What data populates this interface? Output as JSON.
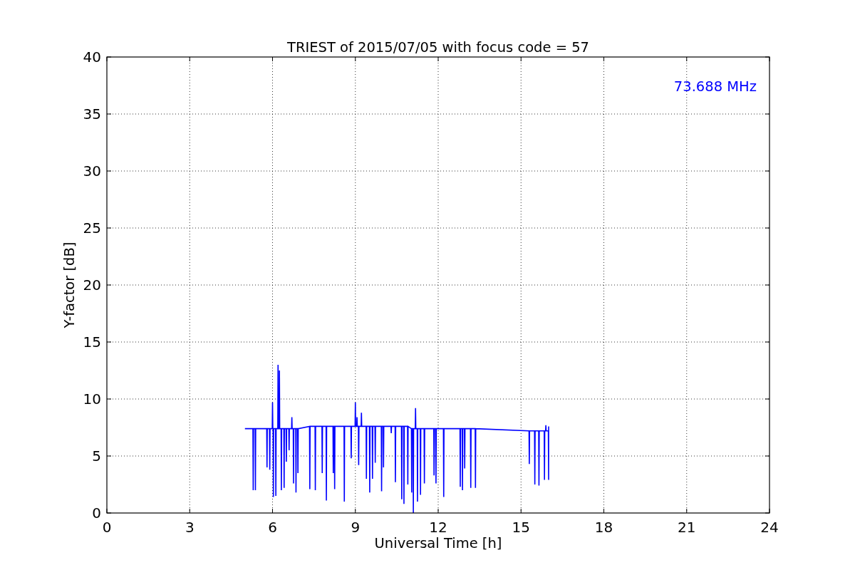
{
  "figure": {
    "chart_data": {
      "type": "line",
      "title": "TRIEST of 2015/07/05 with focus code = 57",
      "xlabel": "Universal Time [h]",
      "ylabel": "Y-factor [dB]",
      "xlim": [
        0,
        24
      ],
      "ylim": [
        0,
        40
      ],
      "xticks": [
        0,
        3,
        6,
        9,
        12,
        15,
        18,
        21,
        24
      ],
      "yticks": [
        0,
        5,
        10,
        15,
        20,
        25,
        30,
        35,
        40
      ],
      "x": [
        5.0,
        5.29,
        5.3,
        5.31,
        5.37,
        5.38,
        5.39,
        5.79,
        5.8,
        5.81,
        5.89,
        5.9,
        5.91,
        5.99,
        6.0,
        6.01,
        6.02,
        6.03,
        6.04,
        6.11,
        6.12,
        6.13,
        6.19,
        6.2,
        6.21,
        6.24,
        6.25,
        6.26,
        6.31,
        6.32,
        6.33,
        6.41,
        6.42,
        6.43,
        6.49,
        6.5,
        6.51,
        6.59,
        6.6,
        6.61,
        6.69,
        6.7,
        6.71,
        6.75,
        6.76,
        6.77,
        6.84,
        6.85,
        6.86,
        6.91,
        6.92,
        6.93,
        7.34,
        7.35,
        7.36,
        7.54,
        7.55,
        7.56,
        7.79,
        7.8,
        7.81,
        7.94,
        7.95,
        7.96,
        8.19,
        8.2,
        8.21,
        8.24,
        8.25,
        8.26,
        8.59,
        8.6,
        8.61,
        8.84,
        8.85,
        8.86,
        8.99,
        9.0,
        9.01,
        9.05,
        9.06,
        9.07,
        9.11,
        9.12,
        9.13,
        9.21,
        9.22,
        9.23,
        9.39,
        9.4,
        9.41,
        9.51,
        9.52,
        9.53,
        9.61,
        9.62,
        9.63,
        9.71,
        9.72,
        9.73,
        9.94,
        9.95,
        9.96,
        10.01,
        10.02,
        10.03,
        10.29,
        10.3,
        10.31,
        10.44,
        10.45,
        10.46,
        10.67,
        10.68,
        10.69,
        10.75,
        10.76,
        10.77,
        10.89,
        10.9,
        10.91,
        11.03,
        11.04,
        11.05,
        11.09,
        11.1,
        11.11,
        11.17,
        11.18,
        11.19,
        11.24,
        11.25,
        11.26,
        11.35,
        11.36,
        11.37,
        11.49,
        11.5,
        11.51,
        11.84,
        11.85,
        11.86,
        11.91,
        11.92,
        11.93,
        12.19,
        12.2,
        12.21,
        12.79,
        12.8,
        12.81,
        12.87,
        12.88,
        12.89,
        12.95,
        12.96,
        12.97,
        13.17,
        13.18,
        13.19,
        13.34,
        13.35,
        13.36,
        15.29,
        15.3,
        15.31,
        15.49,
        15.5,
        15.51,
        15.64,
        15.65,
        15.66,
        15.84,
        15.85,
        15.86,
        15.89,
        15.9,
        15.91,
        15.99,
        16.0,
        16.0
      ],
      "series": [
        {
          "color": "#0000ff",
          "values": [
            7.4,
            7.4,
            2.0,
            7.4,
            7.4,
            2.0,
            7.4,
            7.4,
            4.0,
            7.4,
            7.4,
            3.8,
            7.4,
            7.4,
            9.7,
            7.4,
            7.4,
            1.4,
            7.4,
            7.4,
            1.5,
            7.4,
            7.4,
            13.0,
            7.4,
            7.4,
            12.5,
            7.4,
            7.4,
            2.0,
            7.4,
            7.4,
            2.2,
            7.4,
            7.4,
            4.5,
            7.4,
            7.4,
            5.5,
            7.4,
            7.4,
            8.4,
            7.4,
            7.4,
            2.6,
            7.4,
            7.4,
            1.8,
            7.4,
            7.4,
            3.5,
            7.4,
            7.6,
            2.1,
            7.6,
            7.6,
            2.0,
            7.6,
            7.6,
            3.5,
            7.6,
            7.6,
            1.1,
            7.6,
            7.6,
            3.5,
            7.6,
            7.6,
            2.1,
            7.6,
            7.6,
            1.0,
            7.6,
            7.6,
            4.8,
            7.6,
            7.6,
            9.7,
            7.6,
            7.6,
            8.4,
            7.6,
            7.6,
            4.2,
            7.6,
            7.6,
            8.8,
            7.6,
            7.6,
            3.0,
            7.6,
            7.6,
            1.8,
            7.6,
            7.6,
            3.0,
            7.6,
            7.6,
            4.4,
            7.6,
            7.6,
            1.9,
            7.6,
            7.6,
            4.0,
            7.6,
            7.6,
            7.0,
            7.6,
            7.6,
            2.7,
            7.6,
            7.6,
            1.2,
            7.6,
            7.6,
            0.8,
            7.6,
            7.6,
            2.5,
            7.6,
            7.4,
            1.8,
            7.4,
            7.4,
            0.0,
            7.4,
            7.4,
            9.2,
            7.4,
            7.4,
            1.0,
            7.4,
            7.4,
            1.6,
            7.4,
            7.4,
            2.6,
            7.4,
            7.4,
            3.3,
            7.4,
            7.4,
            2.6,
            7.4,
            7.4,
            1.4,
            7.4,
            7.4,
            2.3,
            7.4,
            7.4,
            2.0,
            7.4,
            7.4,
            3.9,
            7.4,
            7.4,
            2.2,
            7.4,
            7.4,
            2.2,
            7.4,
            7.2,
            4.3,
            7.2,
            7.2,
            2.5,
            7.2,
            7.2,
            2.4,
            7.2,
            7.2,
            2.9,
            7.2,
            7.2,
            7.7,
            7.2,
            7.2,
            2.9,
            7.6
          ]
        }
      ],
      "grid": true,
      "annotations": [
        "73.688 MHz"
      ]
    }
  }
}
